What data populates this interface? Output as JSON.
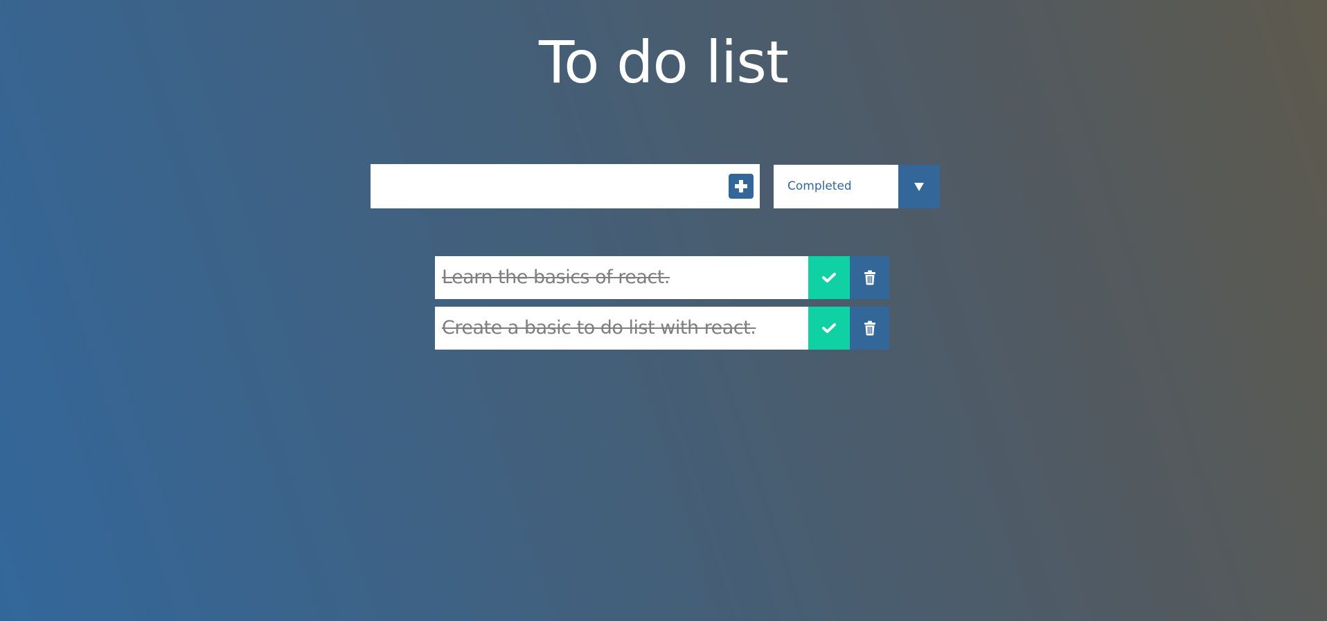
{
  "header": {
    "title": "To do list"
  },
  "add_form": {
    "input_value": "",
    "input_placeholder": "",
    "add_icon": "plus-icon"
  },
  "filter": {
    "selected": "Completed",
    "arrow_icon": "caret-down-icon"
  },
  "todos": [
    {
      "text": "Learn the basics of react.",
      "completed": true,
      "check_icon": "check-icon",
      "trash_icon": "trash-icon"
    },
    {
      "text": "Create a basic to do list with react.",
      "completed": true,
      "check_icon": "check-icon",
      "trash_icon": "trash-icon"
    }
  ],
  "colors": {
    "accent": "#336699",
    "complete": "#0fd1a4",
    "completed_text": "#7e7e7e",
    "title_text": "#ffffff"
  }
}
